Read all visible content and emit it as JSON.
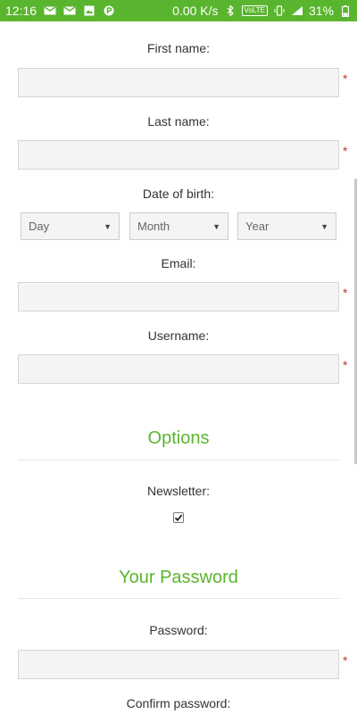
{
  "status_bar": {
    "time": "12:16",
    "net_speed": "0.00 K/s",
    "volte": "VoLTE",
    "battery": "31%",
    "icons": [
      "mail-icon",
      "mail-icon",
      "image-icon",
      "p-icon",
      "bluetooth-icon",
      "vibrate-icon",
      "signal-icon",
      "battery-icon"
    ]
  },
  "form": {
    "first_name_label": "First name:",
    "last_name_label": "Last name:",
    "dob_label": "Date of birth:",
    "dob_day": "Day",
    "dob_month": "Month",
    "dob_year": "Year",
    "email_label": "Email:",
    "username_label": "Username:",
    "options_title": "Options",
    "newsletter_label": "Newsletter:",
    "newsletter_checked": true,
    "password_title": "Your Password",
    "password_label": "Password:",
    "confirm_password_label": "Confirm password:",
    "required_mark": "*"
  },
  "colors": {
    "accent": "#5ab52e",
    "required": "#c0392b"
  }
}
